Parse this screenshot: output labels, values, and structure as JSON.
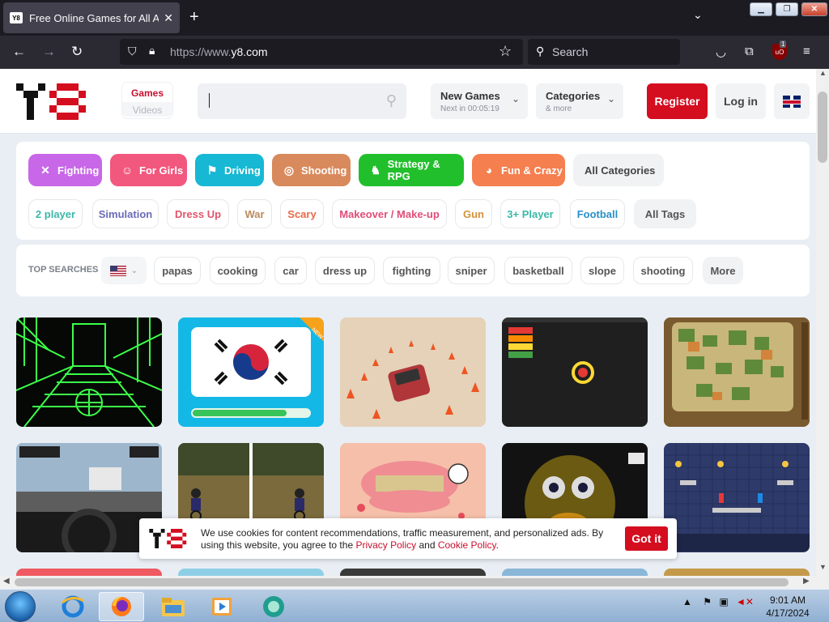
{
  "browser": {
    "tab_title": "Free Online Games for All Ages",
    "tab_favicon": "Y8",
    "url_prefix": "https://www.",
    "url_domain": "y8.com",
    "search_placeholder": "Search",
    "ublock_count": "1"
  },
  "site": {
    "nav_games": "Games",
    "nav_videos": "Videos",
    "new_games_title": "New Games",
    "new_games_sub": "Next in 00:05:19",
    "categories_title": "Categories",
    "categories_sub": "& more",
    "register": "Register",
    "login": "Log in"
  },
  "categories": [
    {
      "label": "Fighting",
      "icon": "fighting-icon",
      "glyph": "✕",
      "color": "#c867e8"
    },
    {
      "label": "For Girls",
      "icon": "girl-icon",
      "glyph": "☺",
      "color": "#f2577d"
    },
    {
      "label": "Driving",
      "icon": "checkered-flag-icon",
      "glyph": "⚑",
      "color": "#17b8d4"
    },
    {
      "label": "Shooting",
      "icon": "target-icon",
      "glyph": "◎",
      "color": "#d98a5c"
    },
    {
      "label": "Strategy & RPG",
      "icon": "chess-icon",
      "glyph": "♞",
      "color": "#22bf2c"
    },
    {
      "label": "Fun & Crazy",
      "icon": "crazy-icon",
      "glyph": "◕",
      "color": "#f57f4f"
    }
  ],
  "all_categories": "All Categories",
  "tags": [
    {
      "label": "2 player",
      "color": "#3bb8a8"
    },
    {
      "label": "Simulation",
      "color": "#6a6ab8"
    },
    {
      "label": "Dress Up",
      "color": "#e0566d"
    },
    {
      "label": "War",
      "color": "#b98b5e"
    },
    {
      "label": "Scary",
      "color": "#e86a4a"
    },
    {
      "label": "Makeover / Make-up",
      "color": "#e04d78"
    },
    {
      "label": "Gun",
      "color": "#d4913a"
    },
    {
      "label": "3+ Player",
      "color": "#3bb8a8"
    },
    {
      "label": "Football",
      "color": "#2a8fc8"
    }
  ],
  "all_tags": "All Tags",
  "top_searches_label": "TOP SEARCHES",
  "top_searches": [
    "papas",
    "cooking",
    "car",
    "dress up",
    "fighting",
    "sniper",
    "basketball",
    "slope",
    "shooting",
    "More"
  ],
  "games_row1_badge": "NEW",
  "cookie": {
    "text_before": "We use cookies for content recommendations, traffic measurement, and personalized ads. By using this website, you agree to the ",
    "privacy": "Privacy Policy",
    "and": " and ",
    "cookie_policy": "Cookie Policy",
    "end": ".",
    "button": "Got it"
  },
  "taskbar": {
    "time": "9:01 AM",
    "date": "4/17/2024"
  },
  "colors": {
    "brand_red": "#d40d1f",
    "browser_dark": "#2b2a33"
  }
}
